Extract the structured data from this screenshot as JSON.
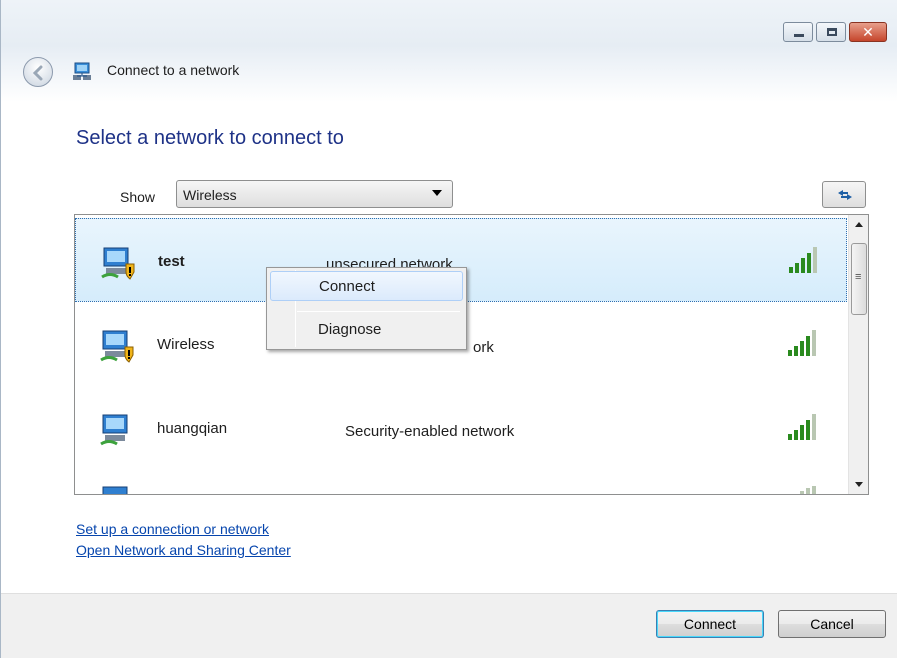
{
  "window": {
    "title": "Connect to a network",
    "controls": {
      "minimize": "minimize",
      "maximize": "maximize",
      "close": "✕"
    }
  },
  "heading": "Select a network to connect to",
  "filter": {
    "label": "Show",
    "selected": "Wireless"
  },
  "networks": [
    {
      "name": "test",
      "security": "unsecured network",
      "bold": true,
      "warning": true,
      "selected": true,
      "signal_bars": 5
    },
    {
      "name": "Wireless",
      "security": "ork",
      "bold": false,
      "warning": true,
      "selected": false,
      "signal_bars": 5
    },
    {
      "name": "huangqian",
      "security": "Security-enabled network",
      "bold": false,
      "warning": false,
      "selected": false,
      "signal_bars": 5
    }
  ],
  "context_menu": {
    "items": [
      "Connect",
      "Diagnose"
    ]
  },
  "links": {
    "setup": "Set up a connection or network",
    "sharing_center": "Open Network and Sharing Center"
  },
  "buttons": {
    "connect": "Connect",
    "cancel": "Cancel"
  },
  "colors": {
    "heading": "#1e3287",
    "link": "#0645ad",
    "signal": "#2a8a1e"
  }
}
